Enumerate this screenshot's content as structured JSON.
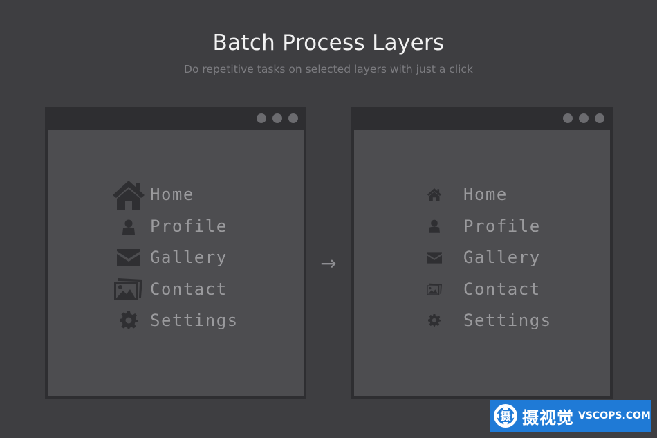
{
  "header": {
    "title": "Batch Process Layers",
    "subtitle": "Do repetitive tasks on selected layers with just a click"
  },
  "menu_items": [
    {
      "label": "Home",
      "icon": "home-icon"
    },
    {
      "label": "Profile",
      "icon": "user-icon"
    },
    {
      "label": "Gallery",
      "icon": "envelope-icon"
    },
    {
      "label": "Contact",
      "icon": "photos-icon"
    },
    {
      "label": "Settings",
      "icon": "gear-icon"
    }
  ],
  "arrow": "→",
  "watermark": {
    "logo_char": "摄",
    "cn_text": "摄视觉",
    "en_text": "VSCOPS.COM"
  },
  "colors": {
    "background": "#3e3e41",
    "window_frame": "#2e2e31",
    "window_content": "#4d4d50",
    "label": "#9a9a9d",
    "watermark": "#1f7ad6"
  }
}
